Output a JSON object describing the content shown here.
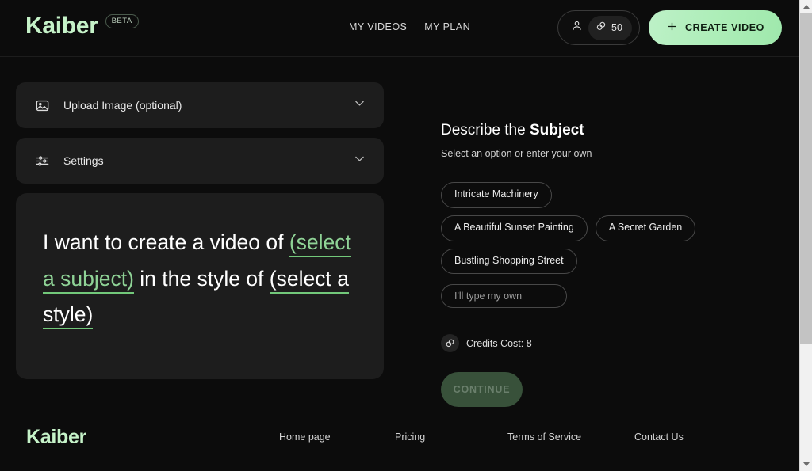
{
  "header": {
    "logo_text": "Kaiber",
    "beta_badge": "BETA",
    "nav": [
      {
        "label": "MY VIDEOS",
        "name": "nav-my-videos"
      },
      {
        "label": "MY PLAN",
        "name": "nav-my-plan"
      }
    ],
    "account": {
      "credits_value": "50",
      "person_icon": "person-icon",
      "credits_icon": "credits-coin-icon"
    },
    "create_button": {
      "label": "CREATE VIDEO",
      "plus_icon": "plus-icon"
    }
  },
  "left_panel": {
    "accordions": [
      {
        "label": "Upload Image (optional)",
        "icon": "image-icon"
      },
      {
        "label": "Settings",
        "icon": "sliders-icon"
      }
    ],
    "prompt": {
      "part1": "I want to create a video of",
      "subject_slot": "(select a subject)",
      "part2": "in the style of",
      "style_slot": "(select a style)"
    }
  },
  "right_panel": {
    "title_prefix": "Describe the ",
    "title_strong": "Subject",
    "subtitle": "Select an option or enter your own",
    "options": [
      "Intricate Machinery",
      "A Beautiful Sunset Painting",
      "A Secret Garden",
      "Bustling Shopping Street"
    ],
    "custom_input": {
      "value": "",
      "placeholder": "I'll type my own"
    },
    "credits_cost_label": "Credits Cost: 8",
    "continue_label": "CONTINUE"
  },
  "footer": {
    "logo_text": "Kaiber",
    "links": [
      "Home page",
      "Pricing",
      "Terms of Service",
      "Contact Us"
    ]
  },
  "colors": {
    "brand_green": "#c5f2c8",
    "accent_underline": "#72c87a",
    "page_bg": "#0c0c0c",
    "card_bg": "#1d1d1d",
    "continue_disabled": "#38513a"
  }
}
